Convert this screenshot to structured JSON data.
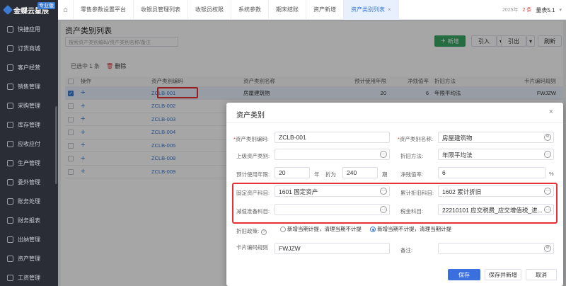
{
  "sidebar": {
    "logo": "金蝶云星辰",
    "badge": "专业版",
    "items": [
      "快捷应用",
      "订货商城",
      "客户经营",
      "销售管理",
      "采购管理",
      "库存管理",
      "应收应付",
      "生产管理",
      "委外管理",
      "账务处理",
      "财务报表",
      "出纳管理",
      "资产管理",
      "工资管理"
    ]
  },
  "topbar": {
    "tabs": [
      "零售参数设置平台",
      "收银员管理列表",
      "收银员权限",
      "系统参数",
      "期末结账",
      "资产新增",
      "资产类别列表"
    ],
    "tab_close": "×",
    "date": "2025年",
    "badge": "2 条",
    "user": "量表5.1"
  },
  "list": {
    "title": "资产类别列表",
    "search_placeholder": "搜索资产类别编码/资产类别名称/备注",
    "add": "新增",
    "import": "引入",
    "export": "引出",
    "refresh": "刷新",
    "selected_info": "已选中 1 条",
    "delete": "删除",
    "columns": [
      "操作",
      "资产类别编码",
      "资产类别名称",
      "预计使用年限",
      "净残值率",
      "折旧方法",
      "卡片编码规则"
    ],
    "rows": [
      {
        "code": "ZCLB-001",
        "name": "房屋建筑物",
        "years": "20",
        "rate": "6",
        "method": "年限平均法",
        "rule": "FWJZW",
        "selected": true
      },
      {
        "code": "ZCLB-002",
        "name": "",
        "years": "",
        "rate": "",
        "method": "",
        "rule": "",
        "selected": false
      },
      {
        "code": "ZCLB-003",
        "name": "",
        "years": "",
        "rate": "",
        "method": "",
        "rule": "",
        "selected": false
      },
      {
        "code": "ZCLB-004",
        "name": "",
        "years": "",
        "rate": "",
        "method": "",
        "rule": "",
        "selected": false
      },
      {
        "code": "ZCLB-005",
        "name": "",
        "years": "",
        "rate": "",
        "method": "",
        "rule": "",
        "selected": false
      },
      {
        "code": "ZCLB-008",
        "name": "",
        "years": "",
        "rate": "",
        "method": "",
        "rule": "",
        "selected": false
      },
      {
        "code": "ZCLB-009",
        "name": "",
        "years": "",
        "rate": "",
        "method": "",
        "rule": "",
        "selected": false
      }
    ]
  },
  "dialog": {
    "title": "资产类别",
    "code_label": "资产类别编码:",
    "code_value": "ZCLB-001",
    "name_label": "资产类别名称:",
    "name_value": "房屋建筑物",
    "parent_label": "上级资产类别:",
    "parent_value": "",
    "method_label": "折旧方法:",
    "method_value": "年限平均法",
    "years_label": "预计使用年限:",
    "years_value": "20",
    "years_unit": "年",
    "depr_label": "折为",
    "depr_value": "240",
    "depr_unit": "期",
    "rate_label": "净残值率:",
    "rate_value": "6",
    "rate_unit": "%",
    "fixed_label": "固定资产科目:",
    "fixed_value": "1601 固定资产",
    "accum_label": "累计折旧科目:",
    "accum_value": "1602 累计折旧",
    "impair_label": "减值准备科目:",
    "impair_value": "",
    "tax_label": "税金科目:",
    "tax_value": "22210101 应交税费_应交增值税_进...",
    "policy_label": "折旧政策:",
    "policy_opt1": "新增当期计提，清理当期不计提",
    "policy_opt2": "新增当期不计提，清理当期计提",
    "rule_label": "卡片编码规则",
    "rule_value": "FWJZW",
    "remark_label": "备注:",
    "remark_value": "",
    "save": "保存",
    "save_new": "保存并新增",
    "cancel": "取消",
    "close": "×"
  }
}
